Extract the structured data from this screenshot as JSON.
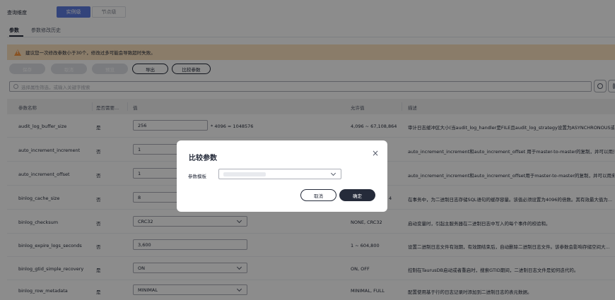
{
  "query_dimension": {
    "label": "查询维度",
    "options": [
      "实例级",
      "节点级"
    ],
    "selected": "实例级"
  },
  "tabs": [
    {
      "label": "参数",
      "active": true
    },
    {
      "label": "参数修改历史",
      "active": false
    }
  ],
  "warning": {
    "text": "建议您一次修改参数小于30个，修改过多可能会导致超时失败。"
  },
  "toolbar": {
    "save": "保存",
    "cancel": "取消",
    "preview": "预览",
    "export": "导出",
    "compare": "比较参数"
  },
  "search": {
    "placeholder": "选择属性筛选，或输入关键字搜索"
  },
  "table": {
    "headers": [
      "参数名称",
      "是否需要...",
      "值",
      "允许值",
      "描述"
    ],
    "rows": [
      {
        "name": "audit_log_buffer_size",
        "restart": "是",
        "value": "256",
        "value_suffix": "* 4096 = 1048576",
        "allowed": "4,096 ~ 67,108,864",
        "desc": "审计日志缓冲区大小(当audit_log_handler是FILE且audit_log_strategy设置为ASYNCHRONOUS或..."
      },
      {
        "name": "auto_increment_increment",
        "restart": "否",
        "value": "1",
        "value_suffix": "",
        "allowed": "",
        "desc": "auto_increment_increment和auto_increment_offset 用于master-to-master的复制，并可以用来控..."
      },
      {
        "name": "auto_increment_offset",
        "restart": "否",
        "value": "1",
        "value_suffix": "",
        "allowed": "",
        "desc": "auto_increment_increment和auto_increment_offset用于master-to-master的复制，并可以用来控..."
      },
      {
        "name": "binlog_cache_size",
        "restart": "否",
        "value": "8",
        "value_suffix": "",
        "allowed": "4",
        "desc": "在事务中，为二进制日志存储SQL语句的缓存容量。该值必须设置为4096的倍数。其有效最大值为..."
      },
      {
        "name": "binlog_checksum",
        "restart": "否",
        "value": "CRC32",
        "value_suffix": "",
        "allowed": "NONE, CRC32",
        "desc": "启动变量时，引起主服务器在二进制日志中写入的每个事件的校验和。"
      },
      {
        "name": "binlog_expire_logs_seconds",
        "restart": "否",
        "value": "3,600",
        "value_suffix": "",
        "allowed": "1 ~ 604,800",
        "desc": "设置二进制日志文件有效期，有效期结束后，自动删除二进制日志文件。该参数会影响存储空间大..."
      },
      {
        "name": "binlog_gtid_simple_recovery",
        "restart": "是",
        "value": "ON",
        "value_suffix": "",
        "allowed": "ON, OFF",
        "desc": "控制在TaurusDB启动或者重启时，搜索GTID期间，二进制日志文件是如何迭代的。"
      },
      {
        "name": "binlog_row_metadata",
        "restart": "是",
        "value": "MINIMAL",
        "value_suffix": "",
        "allowed": "MINIMAL, FULL",
        "desc": "配置使用基于行的日志记录时添加到二进制日志的表元数据。"
      }
    ]
  },
  "modal": {
    "title": "比较参数",
    "close": "×",
    "template_label": "参数模板",
    "cancel": "取消",
    "confirm": "确定"
  }
}
